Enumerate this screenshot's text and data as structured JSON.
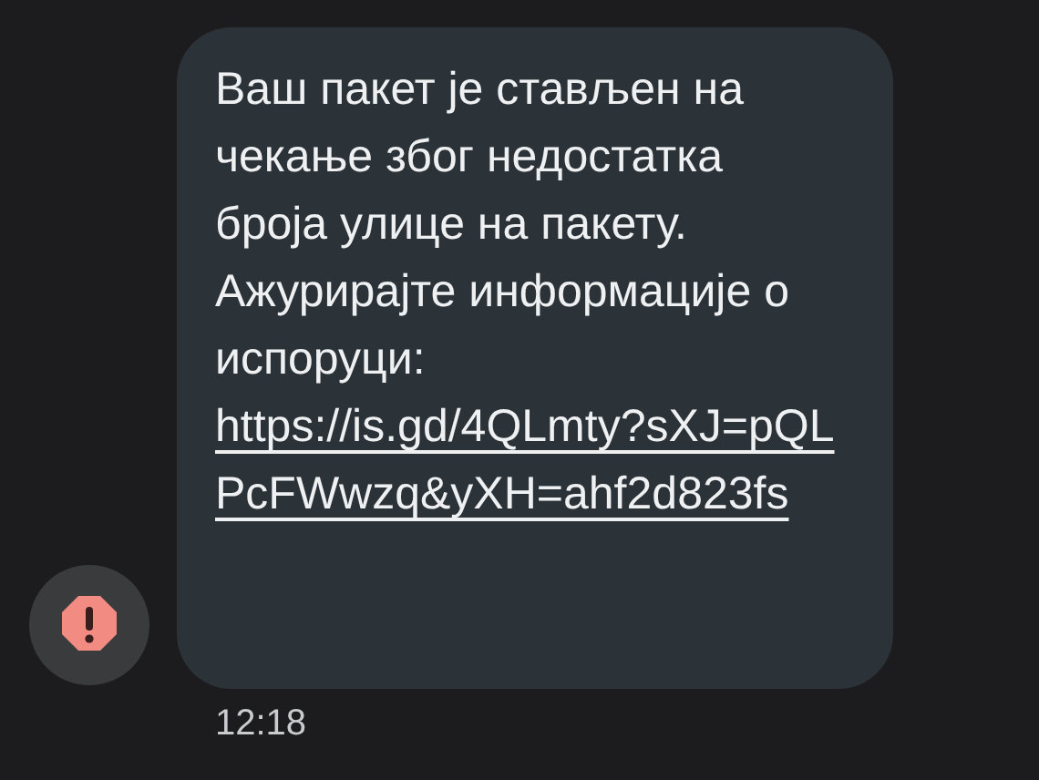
{
  "message": {
    "text": "Ваш пакет је стављен на чекање због недостатка броја улице на пакету. Ажурирајте информације о испоруци:",
    "link": "https://is.gd/4QLmty?sXJ=pQLPcFWwzq&yXH=ahf2d823fs",
    "failed": true,
    "time": "12:18"
  }
}
